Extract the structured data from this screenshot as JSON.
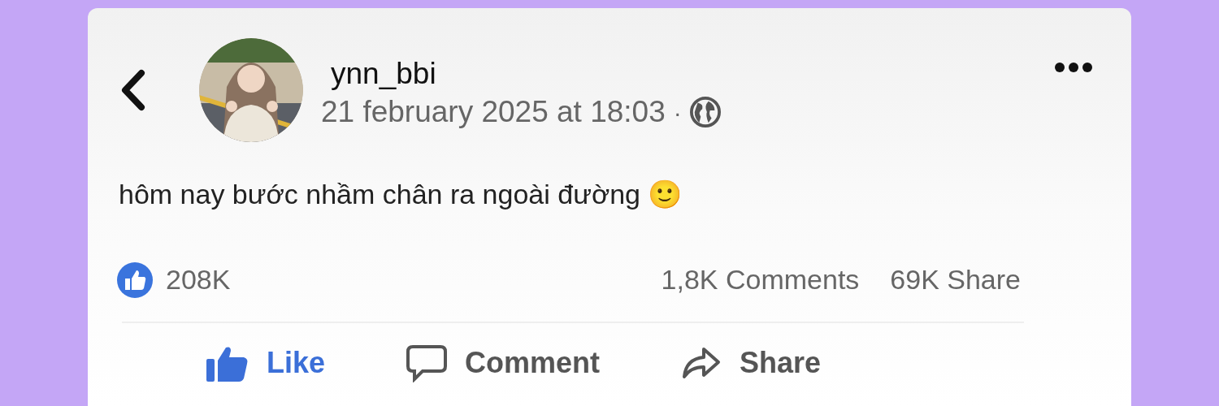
{
  "post": {
    "author": "ynn_bbi",
    "timestamp": "21 february 2025 at 18:03",
    "separator": "·",
    "body": "hôm nay bước nhầm chân ra ngoài đường 🙂"
  },
  "stats": {
    "reactions": "208K",
    "comments": "1,8K Comments",
    "shares": "69K Share"
  },
  "actions": [
    {
      "kind": "like",
      "label": "Like",
      "active": true
    },
    {
      "kind": "comment",
      "label": "Comment",
      "active": false
    },
    {
      "kind": "share",
      "label": "Share",
      "active": false
    }
  ]
}
